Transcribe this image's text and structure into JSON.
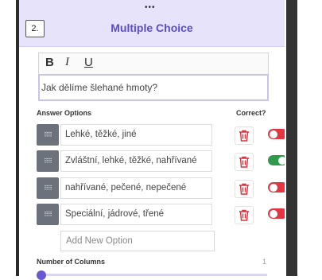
{
  "header": {
    "drag_handle": "•••",
    "question_number": "2.",
    "question_type": "Multiple Choice"
  },
  "toolbar": {
    "bold": "B",
    "italic": "I",
    "underline": "U"
  },
  "question": {
    "text": "Jak dělíme šlehané hmoty?"
  },
  "options_header": {
    "label": "Answer Options",
    "correct_label": "Correct?"
  },
  "options": [
    {
      "text": "Lehké, těžké, jiné",
      "correct": false
    },
    {
      "text": "Zvláštní, lehké, těžké, nahřívané",
      "correct": true
    },
    {
      "text": "nahřívané, pečené, nepečené",
      "correct": false
    },
    {
      "text": "Speciální, jádrové, třené",
      "correct": false
    }
  ],
  "handle_glyph": "⠿⠿",
  "add_option": {
    "placeholder": "Add New Option"
  },
  "columns": {
    "label": "Number of Columns",
    "value": "1",
    "slider_fraction": 0.0
  },
  "colors": {
    "accent": "#5a4ec4",
    "header_bg": "#e6e3fb",
    "toggle_on": "#2f9a4a",
    "toggle_off": "#e53540",
    "delete_icon": "#d9333f"
  },
  "icons": {
    "drag": "drag-handle-icon",
    "delete": "trash-icon",
    "toggle": "toggle-switch"
  }
}
